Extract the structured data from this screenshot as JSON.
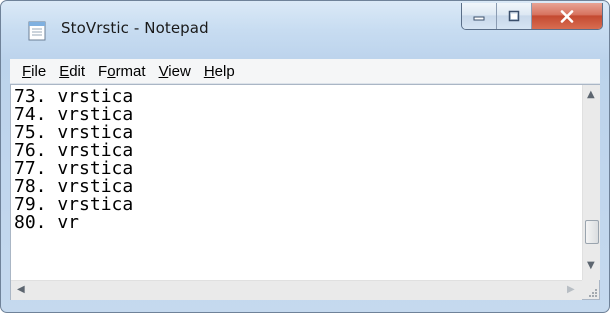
{
  "window": {
    "title": "StoVrstic - Notepad",
    "app_icon": "notepad-icon"
  },
  "caption_buttons": [
    "minimize-icon",
    "maximize-icon",
    "close-icon"
  ],
  "menubar": {
    "items": [
      {
        "label": "File",
        "mnemonic": "F"
      },
      {
        "label": "Edit",
        "mnemonic": "E"
      },
      {
        "label": "Format",
        "mnemonic": "o"
      },
      {
        "label": "View",
        "mnemonic": "V"
      },
      {
        "label": "Help",
        "mnemonic": "H"
      }
    ]
  },
  "editor": {
    "lines": [
      "73. vrstica",
      "74. vrstica",
      "75. vrstica",
      "76. vrstica",
      "77. vrstica",
      "78. vrstica",
      "79. vrstica",
      "80. vr"
    ]
  },
  "colors": {
    "title_bar": "#c7dcf1",
    "close_button": "#c44a31",
    "text": "#000000"
  }
}
